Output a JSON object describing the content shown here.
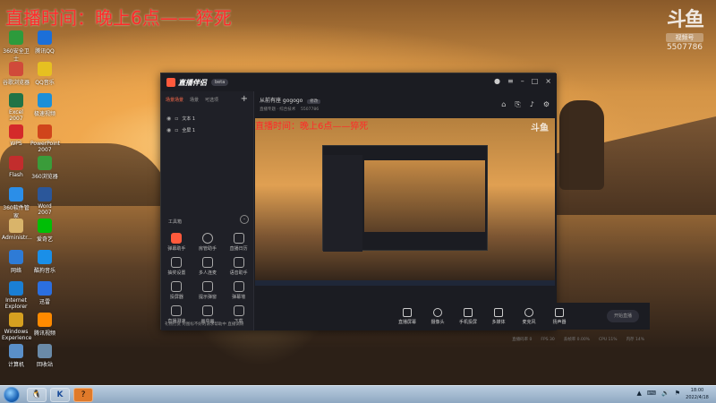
{
  "overlay": {
    "stream_title": "直播时间：晚上6点——猝死",
    "logo_mark": "斗鱼",
    "logo_sub": "视频号",
    "room_number": "5507786"
  },
  "desktop": {
    "icons": [
      {
        "label": "360安全卫士",
        "color": "#2d9b3c"
      },
      {
        "label": "腾讯QQ",
        "color": "#1c6fd8"
      },
      {
        "label": "谷歌浏览器",
        "color": "#d04a3a"
      },
      {
        "label": "QQ音乐",
        "color": "#e6c021"
      },
      {
        "label": "Excel 2007",
        "color": "#217346"
      },
      {
        "label": "极速视频",
        "color": "#1c8fd8"
      },
      {
        "label": "WPS",
        "color": "#d42a2a"
      },
      {
        "label": "PowerPoint 2007",
        "color": "#d0451b"
      },
      {
        "label": "Flash",
        "color": "#c22d2d"
      },
      {
        "label": "360浏览器",
        "color": "#3a9c3a"
      },
      {
        "label": "360软件管家",
        "color": "#2b8ee8"
      },
      {
        "label": "Word 2007",
        "color": "#2b579a"
      },
      {
        "label": "Administr...",
        "color": "#d9b46a"
      },
      {
        "label": "爱奇艺",
        "color": "#00be06"
      },
      {
        "label": "网络",
        "color": "#2e7bd6"
      },
      {
        "label": "酷狗音乐",
        "color": "#1a8fe8"
      },
      {
        "label": "Internet Explorer",
        "color": "#1a7fd4"
      },
      {
        "label": "迅雷",
        "color": "#2b6fe0"
      },
      {
        "label": "Windows Experience",
        "color": "#d6a020"
      },
      {
        "label": "腾讯视频",
        "color": "#ff8a00"
      },
      {
        "label": "计算机",
        "color": "#5a8fc8"
      },
      {
        "label": "回收站",
        "color": "#6a8aa8"
      }
    ]
  },
  "app": {
    "name": "直播伴侣",
    "version": "beta",
    "scene_tabs": [
      "场景场景",
      "场景",
      "可选项"
    ],
    "sources": [
      {
        "label": "文本 1"
      },
      {
        "label": "全屏 1"
      }
    ],
    "tools_title": "工具箱",
    "tools": [
      {
        "label": "弹幕助手",
        "style": "red"
      },
      {
        "label": "房管助手",
        "style": "round"
      },
      {
        "label": "直播日历",
        "style": ""
      },
      {
        "label": "抽奖设置",
        "style": ""
      },
      {
        "label": "多人连麦",
        "style": ""
      },
      {
        "label": "语音助手",
        "style": ""
      },
      {
        "label": "投屏器",
        "style": ""
      },
      {
        "label": "提示弹窗",
        "style": ""
      },
      {
        "label": "弹幕墙",
        "style": ""
      },
      {
        "label": "直播测速",
        "style": ""
      },
      {
        "label": "画中画",
        "style": ""
      },
      {
        "label": "下载",
        "style": ""
      }
    ],
    "footer_text": "礼物打赏  对图标不好的请求帮助中  直播调研",
    "room_title": "从前有座 gogogo",
    "room_badge": "修改",
    "room_sub": "直播专题 · 综合技术",
    "room_id": "5507786",
    "bottom_tools": [
      {
        "label": "直播屏幕",
        "shape": ""
      },
      {
        "label": "摄像头",
        "shape": "circle"
      },
      {
        "label": "手机投屏",
        "shape": ""
      },
      {
        "label": "多媒体",
        "shape": ""
      },
      {
        "label": "麦克风",
        "shape": "circle"
      },
      {
        "label": "扬声器",
        "shape": ""
      }
    ],
    "start_button": "开始直播",
    "status": [
      "直播码率 0",
      "FPS 30",
      "丢帧率 0.00%",
      "CPU 11%",
      "内存 14%"
    ]
  },
  "preview": {
    "title": "直播时间：晚上6点——猝死",
    "logo": "斗鱼"
  },
  "taskbar": {
    "time": "18:00",
    "date": "2022/4/18",
    "tray_icons": [
      "▲",
      "⌨",
      "🔊",
      "⚑"
    ]
  }
}
